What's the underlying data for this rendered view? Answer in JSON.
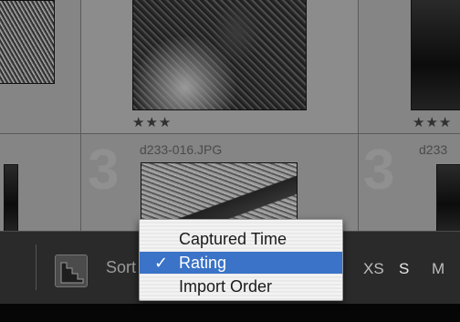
{
  "grid": {
    "cells": [
      {
        "filename": "",
        "rating": ""
      },
      {
        "filename": "",
        "rating": "★★★"
      },
      {
        "filename": "",
        "rating": "★★★"
      },
      {
        "filename": "d233-016.JPG",
        "rating": ""
      },
      {
        "filename": "d233",
        "rating": ""
      }
    ],
    "index_numbers": [
      "3",
      "3"
    ]
  },
  "toolbar": {
    "sort_label": "Sort",
    "sizes": [
      "XS",
      "S",
      "M"
    ],
    "selected_size": "S"
  },
  "sort_menu": {
    "items": [
      {
        "label": "Captured Time",
        "checked": false
      },
      {
        "label": "Rating",
        "checked": true
      },
      {
        "label": "Import Order",
        "checked": false
      }
    ],
    "check_glyph": "✓"
  },
  "colors": {
    "menu_highlight": "#3a73c7",
    "grid_background": "#858585",
    "toolbar_background": "#2a2a2a"
  }
}
